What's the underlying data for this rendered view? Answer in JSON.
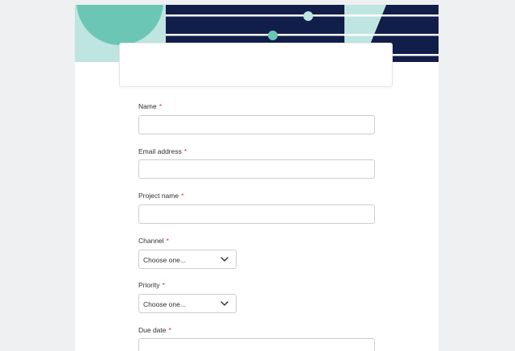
{
  "form": {
    "fields": [
      {
        "label": "Name",
        "required_mark": "*",
        "type": "text",
        "value": ""
      },
      {
        "label": "Email address",
        "required_mark": "*",
        "type": "text",
        "value": ""
      },
      {
        "label": "Project name",
        "required_mark": "*",
        "type": "text",
        "value": ""
      },
      {
        "label": "Channel",
        "required_mark": "*",
        "type": "select",
        "selected": "Choose one..."
      },
      {
        "label": "Priority",
        "required_mark": "*",
        "type": "select",
        "selected": "Choose one..."
      },
      {
        "label": "Due date",
        "required_mark": "*",
        "type": "text",
        "value": ""
      }
    ]
  },
  "colors": {
    "navy": "#121e4a",
    "teal": "#6cc6b6",
    "mint": "#bfe5e0",
    "slider_handle_light": "#bfe5e0",
    "required": "#d0343a"
  },
  "icons": {
    "select_chevron": "chevron-down-icon"
  }
}
